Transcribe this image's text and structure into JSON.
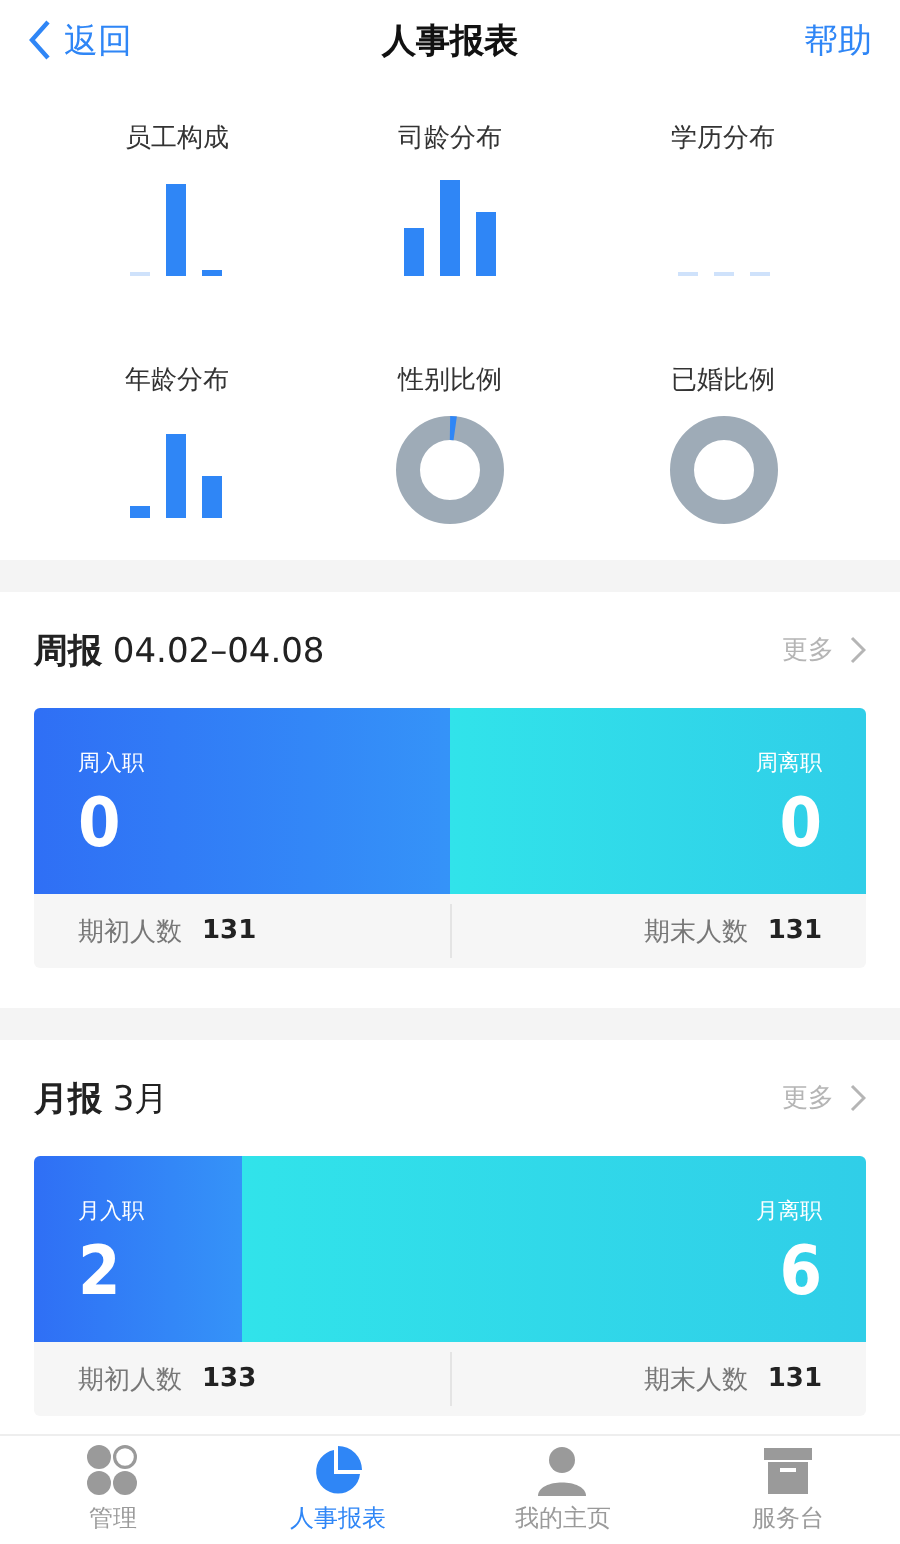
{
  "nav": {
    "back": "返回",
    "title": "人事报表",
    "help": "帮助"
  },
  "mini_charts": [
    {
      "label": "员工构成",
      "kind": "bars-a"
    },
    {
      "label": "司龄分布",
      "kind": "bars-b"
    },
    {
      "label": "学历分布",
      "kind": "bars-empty"
    },
    {
      "label": "年龄分布",
      "kind": "bars-c"
    },
    {
      "label": "性别比例",
      "kind": "donut-sliver"
    },
    {
      "label": "已婚比例",
      "kind": "donut-full"
    }
  ],
  "reports": [
    {
      "title": "周报",
      "period": "04.02–04.08",
      "more": "更多",
      "level": 0.5,
      "join_label": "周入职",
      "join_value": "0",
      "leave_label": "周离职",
      "leave_value": "0",
      "start_label": "期初人数",
      "start_value": "131",
      "end_label": "期末人数",
      "end_value": "131"
    },
    {
      "title": "月报",
      "period": "3月",
      "more": "更多",
      "level": 0.25,
      "join_label": "月入职",
      "join_value": "2",
      "leave_label": "月离职",
      "leave_value": "6",
      "start_label": "期初人数",
      "start_value": "133",
      "end_label": "期末人数",
      "end_value": "131"
    }
  ],
  "tab_bar": [
    {
      "label": "管理",
      "kind": "manage",
      "selected": false
    },
    {
      "label": "人事报表",
      "kind": "report",
      "selected": true
    },
    {
      "label": "我的主页",
      "kind": "profile",
      "selected": false
    },
    {
      "label": "服务台",
      "kind": "desk",
      "selected": false
    }
  ]
}
